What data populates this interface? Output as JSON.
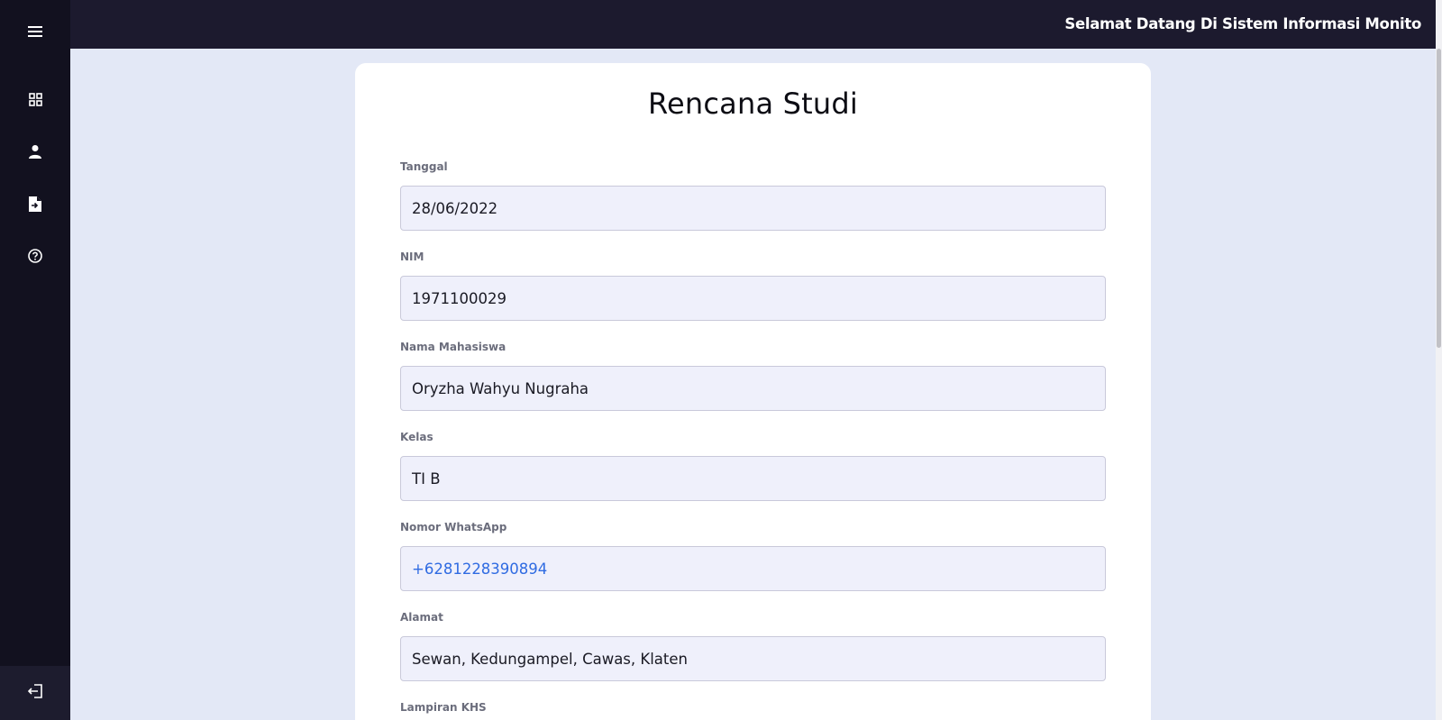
{
  "header": {
    "title": "Selamat Datang Di Sistem Informasi Monito"
  },
  "sidebar": {
    "items": [
      {
        "icon": "menu-icon"
      },
      {
        "icon": "dashboard-icon"
      },
      {
        "icon": "user-icon"
      },
      {
        "icon": "document-icon"
      },
      {
        "icon": "help-icon"
      }
    ],
    "logout_icon": "logout-icon"
  },
  "form": {
    "title": "Rencana Studi",
    "fields": [
      {
        "label": "Tanggal",
        "value": "28/06/2022"
      },
      {
        "label": "NIM",
        "value": "1971100029"
      },
      {
        "label": "Nama Mahasiswa",
        "value": "Oryzha Wahyu Nugraha"
      },
      {
        "label": "Kelas",
        "value": "TI B"
      },
      {
        "label": "Nomor WhatsApp",
        "value": "+6281228390894"
      },
      {
        "label": "Alamat",
        "value": "Sewan, Kedungampel, Cawas, Klaten"
      },
      {
        "label": "Lampiran KHS",
        "value": ""
      }
    ]
  },
  "colors": {
    "sidebar_bg": "#12111f",
    "topbar_bg": "#1c1a2e",
    "page_bg": "#e3e8f6",
    "input_bg": "#eff0fb",
    "link": "#2f6be2"
  }
}
